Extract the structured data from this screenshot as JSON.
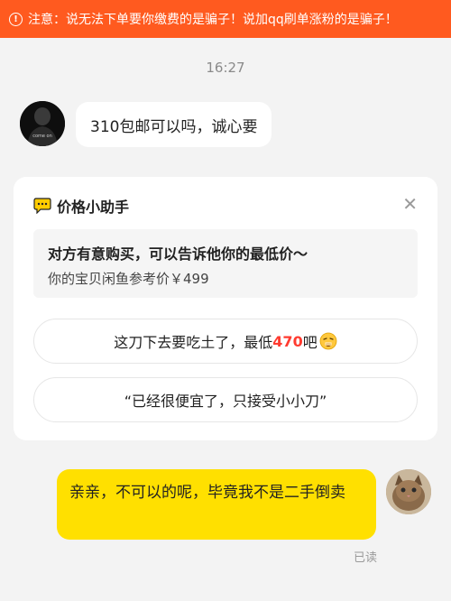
{
  "warning_bar": {
    "text": "注意：说无法下单要你缴费的是骗子！说加qq刷单涨粉的是骗子！",
    "icon": "warning-circle-icon"
  },
  "chat": {
    "time": "16:27",
    "incoming": {
      "avatar": "buyer-avatar",
      "avatar_text": "come on",
      "text": "310包邮可以吗，诚心要"
    },
    "outgoing": {
      "avatar": "seller-avatar",
      "text": "亲亲，不可以的呢，毕竟我不是二手倒卖",
      "status": "已读"
    }
  },
  "price_helper": {
    "title": "价格小助手",
    "info_title": "对方有意购买，可以告诉他你的最低价～",
    "info_sub": "你的宝贝闲鱼参考价￥499",
    "options": [
      {
        "prefix": "这刀下去要吃土了，最低",
        "price": "470",
        "suffix": "吧",
        "emoji": "weary-face-emoji"
      },
      {
        "text": "“已经很便宜了，只接受小小刀”"
      }
    ]
  },
  "colors": {
    "warning_bg": "#ff5a1f",
    "own_bubble": "#ffe000",
    "price_highlight": "#ff3b30",
    "background": "#f3f3f3"
  }
}
